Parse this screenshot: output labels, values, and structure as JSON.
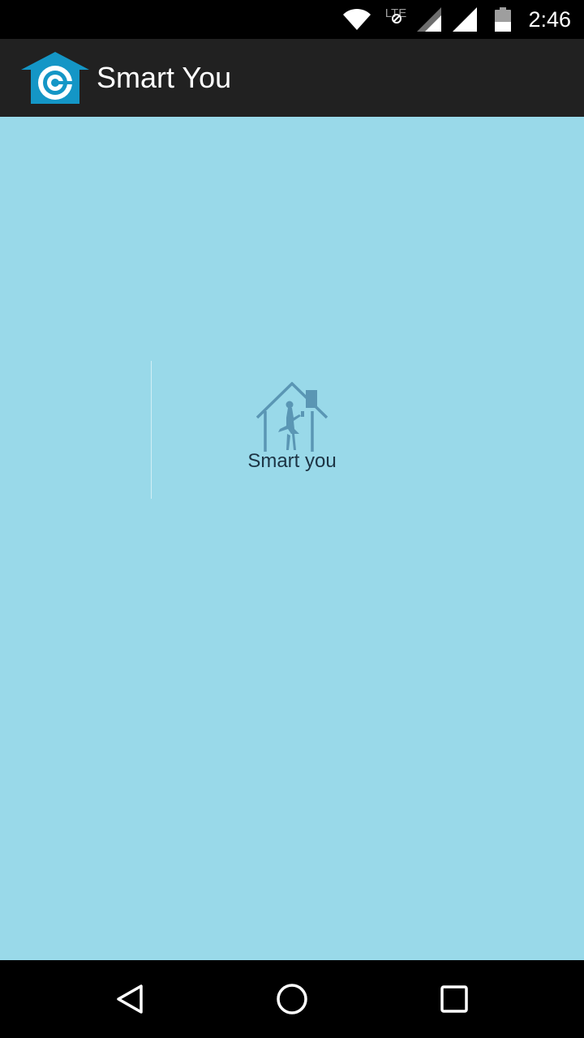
{
  "status_bar": {
    "time": "2:46",
    "network_label": "LTE",
    "icons": [
      "wifi-icon",
      "lte-no-data-icon",
      "cell-signal-icon",
      "cell-signal-icon",
      "battery-icon"
    ]
  },
  "action_bar": {
    "title": "Smart You",
    "logo_icon": "house-target-icon"
  },
  "content": {
    "background_color": "#99d9e9",
    "splash_text": "Smart you",
    "splash_icon": "house-woman-icon"
  },
  "nav_bar": {
    "buttons": [
      "back-icon",
      "home-icon",
      "recents-icon"
    ]
  },
  "colors": {
    "action_bar": "#212121",
    "status_bar": "#000000",
    "logo_blue": "#1496c6",
    "splash_icon": "#5a96b4"
  }
}
